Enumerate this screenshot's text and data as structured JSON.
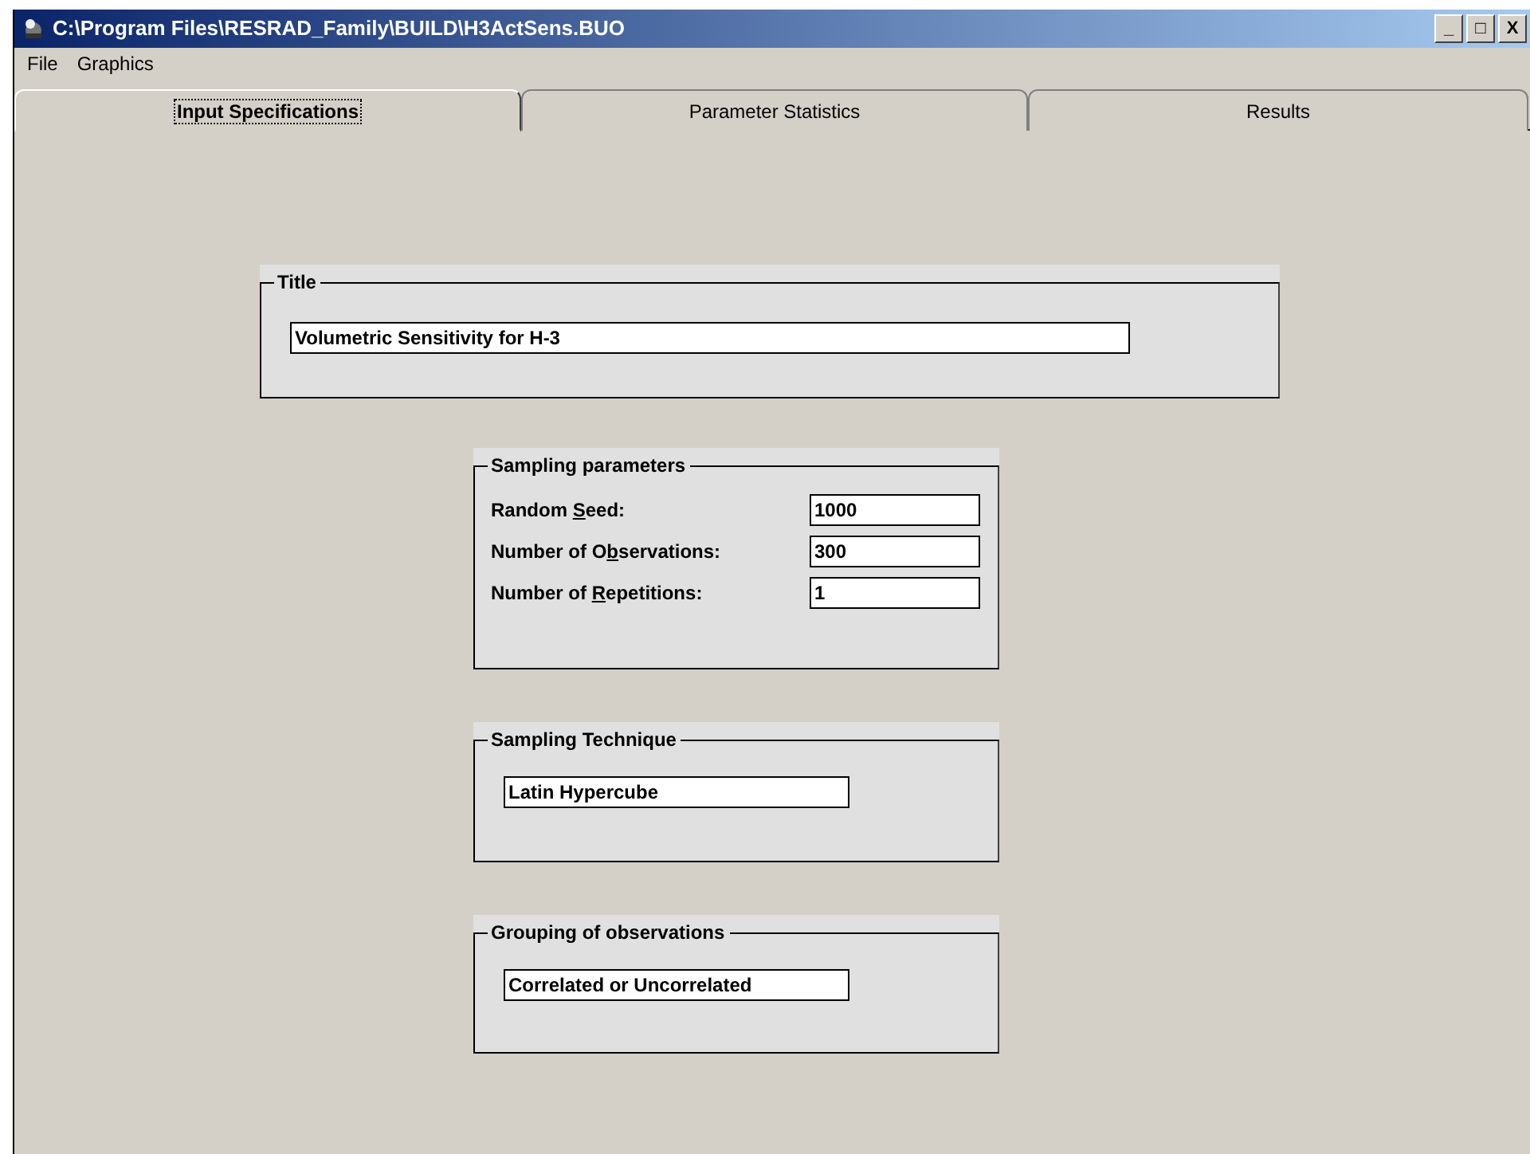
{
  "window": {
    "title": "C:\\Program Files\\RESRAD_Family\\BUILD\\H3ActSens.BUO",
    "controls": [
      "_",
      "□",
      "X"
    ]
  },
  "menu": [
    "File",
    "Graphics"
  ],
  "tabs": [
    {
      "label": "Input Specifications",
      "selected": true
    },
    {
      "label": "Parameter Statistics",
      "selected": false
    },
    {
      "label": "Results",
      "selected": false
    }
  ],
  "title_group": {
    "legend": "Title",
    "value": "Volumetric Sensitivity for H-3"
  },
  "sampling_parameters": {
    "legend": "Sampling parameters",
    "fields": [
      {
        "label": {
          "before": "Random ",
          "key": "S",
          "after": "eed:"
        },
        "value": "1000"
      },
      {
        "label": {
          "before": "Number of O",
          "key": "b",
          "after": "servations:"
        },
        "value": "300"
      },
      {
        "label": {
          "before": "Number of ",
          "key": "R",
          "after": "epetitions:"
        },
        "value": "1"
      }
    ]
  },
  "sampling_technique": {
    "legend": "Sampling Technique",
    "value": "Latin Hypercube"
  },
  "grouping": {
    "legend": "Grouping of observations",
    "value": "Correlated or Uncorrelated"
  }
}
